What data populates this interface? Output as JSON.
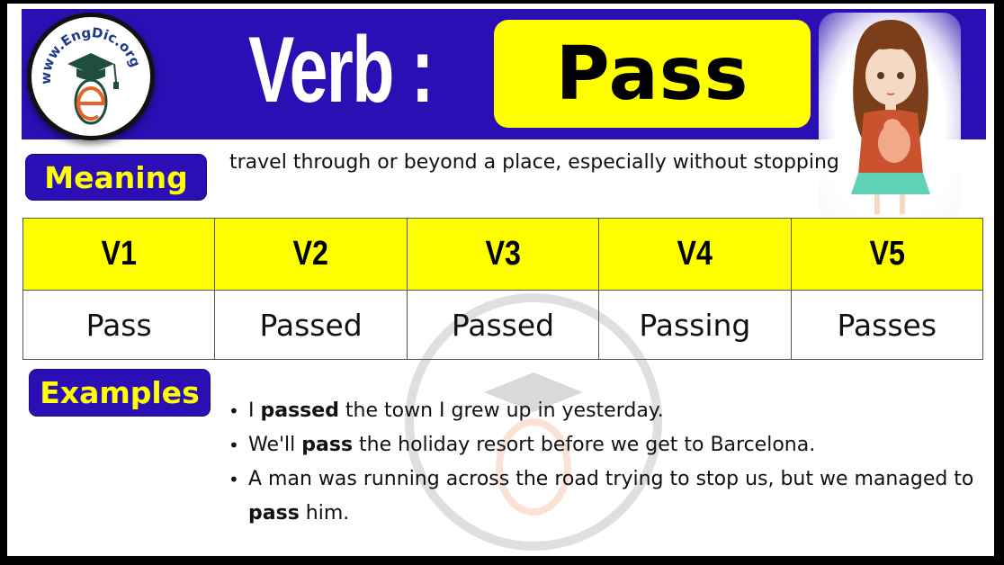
{
  "header": {
    "logo_text": "www.EngDic.org",
    "title_prefix": "Verb :",
    "word": "Pass"
  },
  "colors": {
    "header_blue": "#2b0fb4",
    "highlight_yellow": "#ffff00",
    "logo_orange": "#e8632a",
    "logo_navy": "#1f3a8a",
    "cap_green": "#1f4d3e"
  },
  "meaning": {
    "label": "Meaning",
    "text": "travel through or beyond a place, especially without stopping"
  },
  "forms_table": {
    "headers": [
      "V1",
      "V2",
      "V3",
      "V4",
      "V5"
    ],
    "values": [
      "Pass",
      "Passed",
      "Passed",
      "Passing",
      "Passes"
    ]
  },
  "examples": {
    "label": "Examples",
    "items": [
      {
        "before": "I ",
        "bold": "passed",
        "after": " the town I grew up in yesterday."
      },
      {
        "before": "We'll ",
        "bold": "pass",
        "after": " the holiday resort before we get to Barcelona."
      },
      {
        "before": "A man was running across the road trying to stop us, but we managed to ",
        "bold": "pass",
        "after": " him."
      }
    ]
  },
  "illustration": {
    "subject": "girl-holding-cat"
  }
}
